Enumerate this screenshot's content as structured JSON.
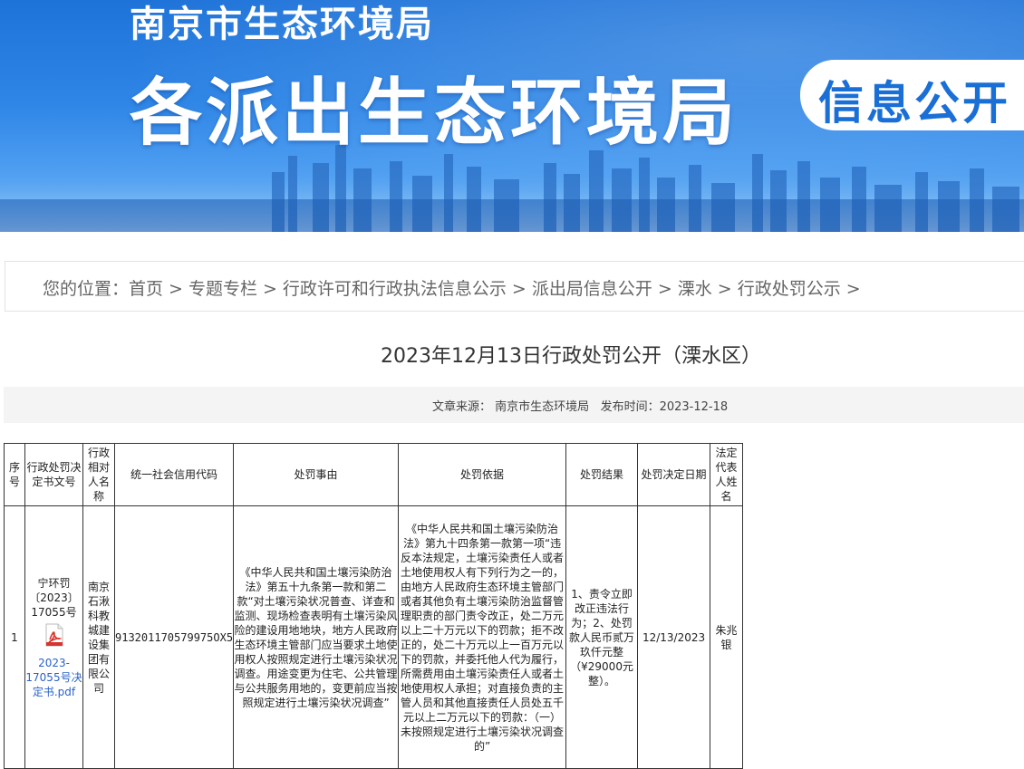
{
  "banner": {
    "org": "南京市生态环境局",
    "headline": "各派出生态环境局",
    "badge": "信息公开"
  },
  "breadcrumb": {
    "prefix": "您的位置：",
    "items": [
      "首页",
      "专题专栏",
      "行政许可和行政执法信息公示",
      "派出局信息公开",
      "溧水",
      "行政处罚公示"
    ]
  },
  "article": {
    "title": "2023年12月13日行政处罚公开（溧水区）",
    "source_label": "文章来源：",
    "source": "南京市生态环境局",
    "date_label": "发布时间：",
    "date": "2023-12-18"
  },
  "table": {
    "headers": [
      "序号",
      "行政处罚决定书文号",
      "行政相对人名称",
      "统一社会信用代码",
      "处罚事由",
      "处罚依据",
      "处罚结果",
      "处罚决定日期",
      "法定代表人姓名"
    ],
    "rows": [
      {
        "index": "1",
        "doc_no": "宁环罚〔2023〕17055号",
        "attachment": "2023-17055号决定书.pdf",
        "party": "南京石湫科教城建设集团有限公司",
        "credit_code": "913201170579975OX5",
        "reason": "《中华人民共和国土壤污染防治法》第五十九条第一款和第二款“对土壤污染状况普查、详查和监测、现场检查表明有土壤污染风险的建设用地地块，地方人民政府生态环境主管部门应当要求土地使用权人按照规定进行土壤污染状况调查。用途变更为住宅、公共管理与公共服务用地的，变更前应当按照规定进行土壤污染状况调查”",
        "basis": "《中华人民共和国土壤污染防治法》第九十四条第一款第一项“违反本法规定，土壤污染责任人或者土地使用权人有下列行为之一的，由地方人民政府生态环境主管部门或者其他负有土壤污染防治监督管理职责的部门责令改正，处二万元以上二十万元以下的罚款；拒不改正的，处二十万元以上一百万元以下的罚款，并委托他人代为履行，所需费用由土壤污染责任人或者土地使用权人承担；对直接负责的主管人员和其他直接责任人员处五千元以上二万元以下的罚款：（一）未按照规定进行土壤污染状况调查的”",
        "result": "1、责令立即改正违法行为；2、处罚款人民币贰万玖仟元整（¥29000元整）。",
        "date": "12/13/2023",
        "legal_rep": "朱兆银"
      }
    ]
  },
  "colors": {
    "banner_top": "#1e73d9",
    "banner_badge_text": "#1a6fd6",
    "link": "#2a62c9",
    "pdf_red": "#d9342b"
  },
  "icons": [
    "pdf-icon"
  ]
}
